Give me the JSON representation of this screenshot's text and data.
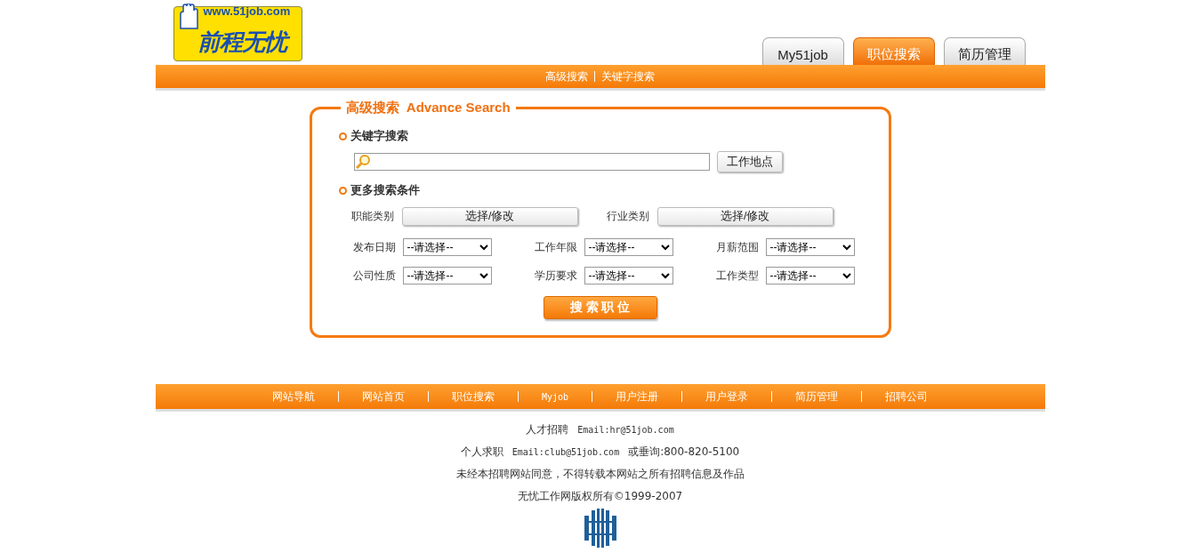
{
  "logo": {
    "url": "www.51job.com",
    "name": "前程无忧"
  },
  "tabs": [
    {
      "label": "My51job",
      "selected": false
    },
    {
      "label": "职位搜索",
      "selected": true
    },
    {
      "label": "简历管理",
      "selected": false
    }
  ],
  "subnav": [
    "高级搜索",
    "关键字搜索"
  ],
  "search_panel": {
    "title": "高级搜索  Advance Search",
    "keyword_section": "关键字搜索",
    "location_button": "工作地点",
    "more_section": "更多搜索条件",
    "pickers": [
      {
        "label": "职能类别",
        "button": "选择/修改"
      },
      {
        "label": "行业类别",
        "button": "选择/修改"
      }
    ],
    "selects": [
      {
        "label": "发布日期",
        "value": "--请选择--"
      },
      {
        "label": "工作年限",
        "value": "--请选择--"
      },
      {
        "label": "月薪范围",
        "value": "--请选择--"
      },
      {
        "label": "公司性质",
        "value": "--请选择--"
      },
      {
        "label": "学历要求",
        "value": "--请选择--"
      },
      {
        "label": "工作类型",
        "value": "--请选择--"
      }
    ],
    "search_button": "搜 索 职 位"
  },
  "footer_nav": [
    "网站导航",
    "网站首页",
    "职位搜索",
    "Myjob",
    "用户注册",
    "用户登录",
    "简历管理",
    "招聘公司"
  ],
  "footer_lines": [
    [
      "人才招聘",
      "Email:hr@51job.com"
    ],
    [
      "个人求职",
      "Email:club@51job.com",
      "或垂询:800-820-5100"
    ],
    [
      "未经本招聘网站同意，不得转载本网站之所有招聘信息及作品"
    ],
    [
      "无忧工作网版权所有©1999-2007"
    ]
  ]
}
